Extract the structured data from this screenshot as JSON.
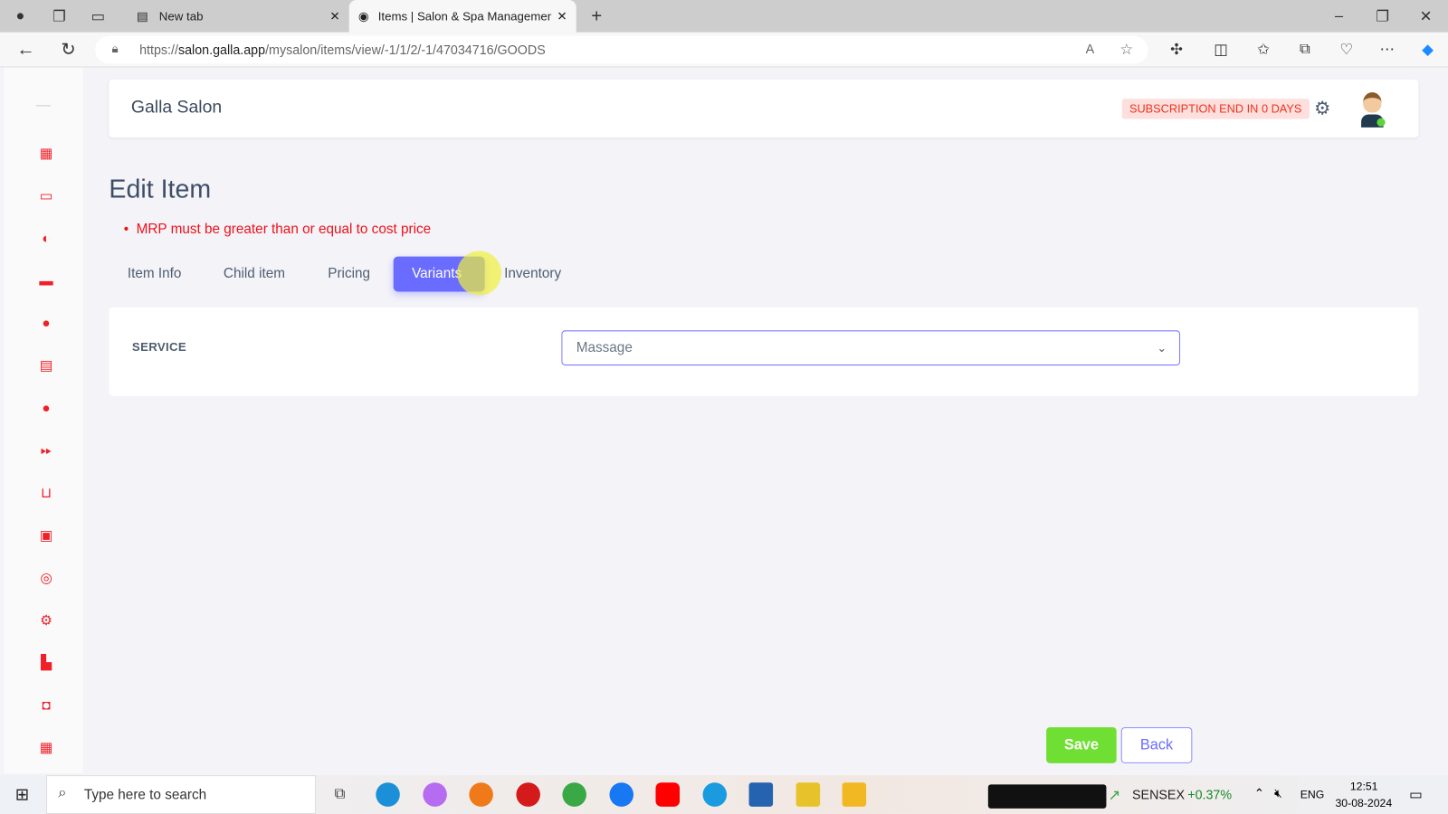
{
  "browser": {
    "tabs": [
      {
        "label": "New tab"
      },
      {
        "label": "Items | Salon & Spa Management",
        "active": true
      }
    ],
    "url_prefix": "https://",
    "url_host": "salon.galla.app",
    "url_path": "/mysalon/items/view/-1/1/2/-1/47034716/GOODS"
  },
  "header": {
    "brand": "Galla Salon",
    "subscription": "SUBSCRIPTION END IN 0 DAYS"
  },
  "sidebar": {
    "icons": [
      "dashboard-icon",
      "folder-icon",
      "contrast-icon",
      "coupon-icon",
      "user-icon",
      "document-icon",
      "user-icon",
      "fast-forward-icon",
      "basket-icon",
      "contacts-icon",
      "location-icon",
      "settings-icon",
      "report-icon",
      "cash-icon",
      "calendar-icon"
    ],
    "accent": "#f0202a"
  },
  "page": {
    "title": "Edit Item",
    "error": "MRP must be greater than or equal to cost price",
    "tabs": [
      "Item Info",
      "Child item",
      "Pricing",
      "Variants",
      "Inventory"
    ],
    "active_tab": "Variants",
    "service_label": "SERVICE",
    "service_value": "Massage",
    "save": "Save",
    "back": "Back"
  },
  "taskbar": {
    "search_placeholder": "Type here to search",
    "ticker": "SENSEX",
    "ticker_change": "+0.37%",
    "lang": "ENG",
    "time": "12:51",
    "date": "30-08-2024"
  }
}
